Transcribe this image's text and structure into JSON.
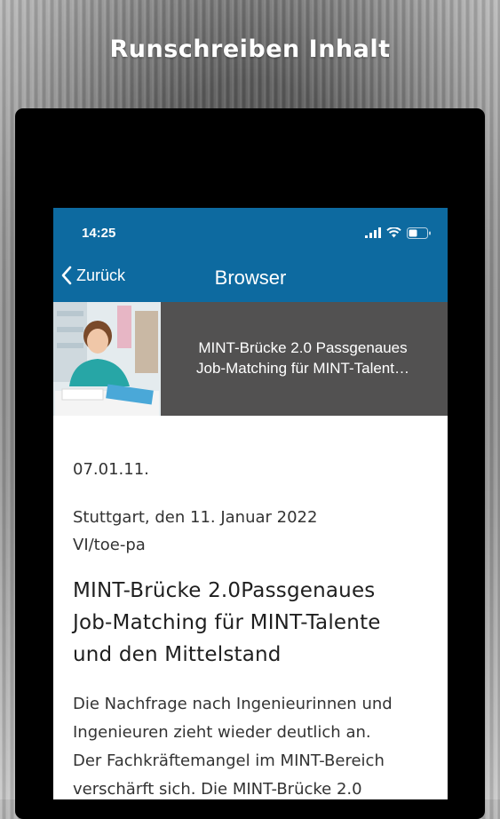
{
  "banner": {
    "title": "Runschreiben Inhalt"
  },
  "status_bar": {
    "time": "14:25"
  },
  "nav": {
    "back_label": "Zurück",
    "title": "Browser"
  },
  "article_header": {
    "title_line1": "MINT-Brücke 2.0 Passgenaues",
    "title_line2": "Job-Matching für MINT-Talent…"
  },
  "article": {
    "date": "07.01.11.",
    "place_date": "Stuttgart, den 11. Januar 2022",
    "reference": "VI/toe-pa",
    "heading_line1": "MINT-Brücke 2.0Passgenaues",
    "heading_line2": "Job-Matching für MINT-Talente",
    "heading_line3": "und den Mittelstand",
    "body_line1": "Die Nachfrage nach Ingenieurinnen und",
    "body_line2": "Ingenieuren zieht wieder deutlich an.",
    "body_line3": "Der Fachkräftemangel im MINT-Bereich",
    "body_line4": "verschärft sich. Die MINT-Brücke 2.0"
  },
  "colors": {
    "app_bar": "#0d6aa0",
    "header_band": "#525151"
  }
}
